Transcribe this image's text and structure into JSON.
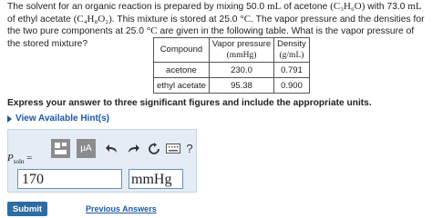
{
  "problem": {
    "p1": "The solvent for an organic reaction is prepared by mixing 50.0",
    "u1": "mL",
    "p2": "of acetone",
    "f1": "(C₃H₆O)",
    "p3": "with 73.0",
    "u2": "mL",
    "p4": "of ethyl acetate",
    "f2": "(C₄H₈O₂)",
    "p5": ". This mixture is stored at 25.0",
    "deg1": "°C",
    "p6": ". The vapor pressure and the densities for the two pure components at 25.0",
    "deg2": "°C",
    "p7": "are given in the following table. What is the vapor pressure of the stored mixture?"
  },
  "table": {
    "headers": [
      "Compound",
      "Vapor pressure",
      "Density"
    ],
    "units": [
      "",
      "(mmHg)",
      "(g/mL)"
    ],
    "rows": [
      [
        "acetone",
        "230.0",
        "0.791"
      ],
      [
        "ethyl acetate",
        "95.38",
        "0.900"
      ]
    ]
  },
  "instructions": "Express your answer to three significant figures and include the appropriate units.",
  "hints_link": "View Available Hint(s)",
  "toolbar": {
    "units_label": "μA",
    "help": "?"
  },
  "answer": {
    "label_main": "P",
    "label_sub": "soln",
    "label_eq": "=",
    "value": "170",
    "unit": "mmHg"
  },
  "buttons": {
    "submit": "Submit",
    "previous": "Previous Answers"
  }
}
